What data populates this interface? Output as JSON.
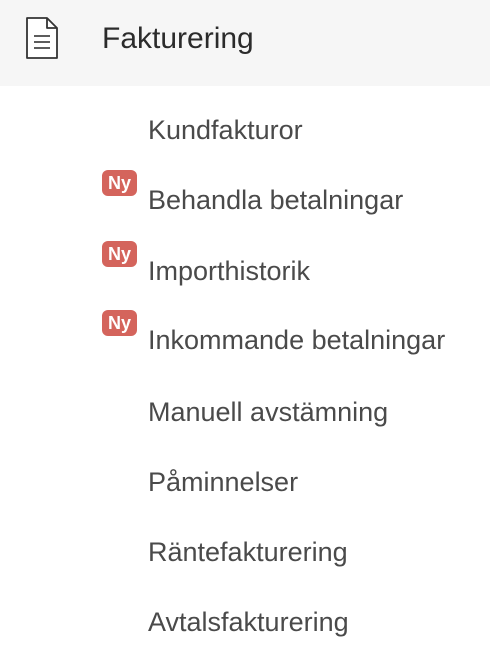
{
  "header": {
    "title": "Fakturering",
    "icon": "document-icon"
  },
  "badge_color": "#d4645c",
  "items": [
    {
      "label": "Kundfakturor",
      "badge": null
    },
    {
      "label": "Behandla betalningar",
      "badge": "Ny"
    },
    {
      "label": "Importhistorik",
      "badge": "Ny"
    },
    {
      "label": "Inkommande betalningar",
      "badge": "Ny"
    },
    {
      "label": "Manuell avstämning",
      "badge": null
    },
    {
      "label": "Påminnelser",
      "badge": null
    },
    {
      "label": "Räntefakturering",
      "badge": null
    },
    {
      "label": "Avtalsfakturering",
      "badge": null
    }
  ]
}
